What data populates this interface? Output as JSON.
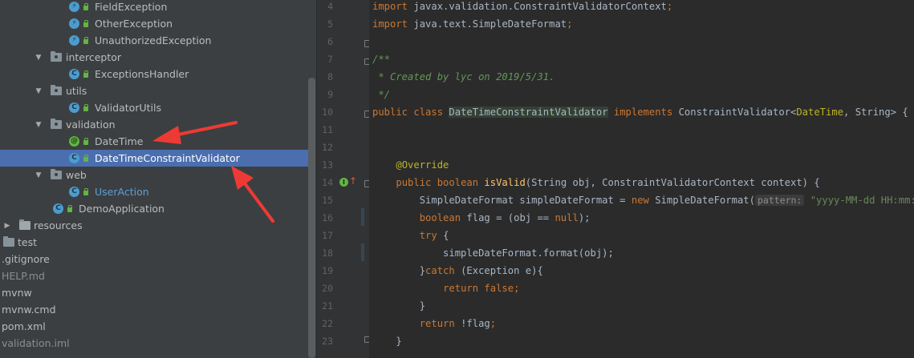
{
  "project_tree": {
    "items": [
      {
        "label": "FieldException",
        "kind": "exception"
      },
      {
        "label": "OtherException",
        "kind": "exception"
      },
      {
        "label": "UnauthorizedException",
        "kind": "exception"
      },
      {
        "label": "interceptor",
        "kind": "package"
      },
      {
        "label": "ExceptionsHandler",
        "kind": "class"
      },
      {
        "label": "utils",
        "kind": "package"
      },
      {
        "label": "ValidatorUtils",
        "kind": "class"
      },
      {
        "label": "validation",
        "kind": "package"
      },
      {
        "label": "DateTime",
        "kind": "annotation"
      },
      {
        "label": "DateTimeConstraintValidator",
        "kind": "class",
        "selected": true
      },
      {
        "label": "web",
        "kind": "package"
      },
      {
        "label": "UserAction",
        "kind": "class"
      },
      {
        "label": "DemoApplication",
        "kind": "spring-class"
      },
      {
        "label": "resources",
        "kind": "folder"
      },
      {
        "label": "test",
        "kind": "folder"
      },
      {
        "label": ".gitignore",
        "kind": "file"
      },
      {
        "label": "HELP.md",
        "kind": "file"
      },
      {
        "label": "mvnw",
        "kind": "file"
      },
      {
        "label": "mvnw.cmd",
        "kind": "file"
      },
      {
        "label": "pom.xml",
        "kind": "file"
      },
      {
        "label": "validation.iml",
        "kind": "file"
      }
    ]
  },
  "icons": {
    "class_glyph": "C",
    "annotation_glyph": "@",
    "exception_glyph": "⚡",
    "expand_glyph": "▼",
    "collapse_glyph": "▶"
  },
  "gutter": {
    "line_numbers": [
      "4",
      "5",
      "6",
      "7",
      "8",
      "9",
      "10",
      "11",
      "12",
      "13",
      "14",
      "15",
      "16",
      "17",
      "18",
      "19",
      "20",
      "21",
      "22",
      "23"
    ]
  },
  "editor": {
    "lines": [
      [
        {
          "t": "import ",
          "c": "kw"
        },
        {
          "t": "javax.validation.ConstraintValidatorContext"
        },
        {
          "t": ";",
          "c": "sem"
        }
      ],
      [
        {
          "t": "import ",
          "c": "kw"
        },
        {
          "t": "java.text.SimpleDateFormat"
        },
        {
          "t": ";",
          "c": "sem"
        }
      ],
      [],
      [
        {
          "t": "/**",
          "c": "cm"
        }
      ],
      [
        {
          "t": " * Created by lyc on 2019/5/31.",
          "c": "cm"
        }
      ],
      [
        {
          "t": " */",
          "c": "cm"
        }
      ],
      [
        {
          "t": "public class ",
          "c": "kw"
        },
        {
          "t": "DateTimeConstraintValidator",
          "c": "hl"
        },
        {
          "t": " implements ",
          "c": "kw"
        },
        {
          "t": "ConstraintValidator<"
        },
        {
          "t": "DateTime",
          "c": "an"
        },
        {
          "t": ", String> {"
        }
      ],
      [],
      [],
      [
        {
          "t": "    "
        },
        {
          "t": "@Override",
          "c": "an"
        }
      ],
      [
        {
          "t": "    "
        },
        {
          "t": "public boolean ",
          "c": "kw"
        },
        {
          "t": "isValid",
          "c": "fn"
        },
        {
          "t": "(String obj, ConstraintValidatorContext context) {"
        }
      ],
      [
        {
          "t": "        SimpleDateFormat simpleDateFormat = "
        },
        {
          "t": "new ",
          "c": "kw"
        },
        {
          "t": "SimpleDateFormat("
        },
        {
          "t": "pattern:",
          "c": "hint"
        },
        {
          "t": " \"yyyy-MM-dd HH:mm:ss\"",
          "c": "st"
        },
        {
          "t": ");"
        }
      ],
      [
        {
          "t": "        "
        },
        {
          "t": "boolean ",
          "c": "kw"
        },
        {
          "t": "flag = (obj == "
        },
        {
          "t": "null",
          "c": "kw"
        },
        {
          "t": ");"
        }
      ],
      [
        {
          "t": "        "
        },
        {
          "t": "try ",
          "c": "kw"
        },
        {
          "t": "{"
        }
      ],
      [
        {
          "t": "            simpleDateFormat.format(obj);"
        }
      ],
      [
        {
          "t": "        }"
        },
        {
          "t": "catch ",
          "c": "kw"
        },
        {
          "t": "(Exception e){"
        }
      ],
      [
        {
          "t": "            "
        },
        {
          "t": "return false",
          "c": "kw"
        },
        {
          "t": ";",
          "c": "sem"
        }
      ],
      [
        {
          "t": "        }"
        }
      ],
      [
        {
          "t": "        "
        },
        {
          "t": "return ",
          "c": "kw"
        },
        {
          "t": "!flag"
        },
        {
          "t": ";",
          "c": "sem"
        }
      ],
      [
        {
          "t": "    }"
        }
      ]
    ]
  },
  "colors": {
    "tree_bg": "#3c3f41",
    "selection": "#4b6eaf",
    "editor_bg": "#2b2b2b",
    "keyword": "#cc7832",
    "annotation_arrow": "#ee3a34"
  }
}
